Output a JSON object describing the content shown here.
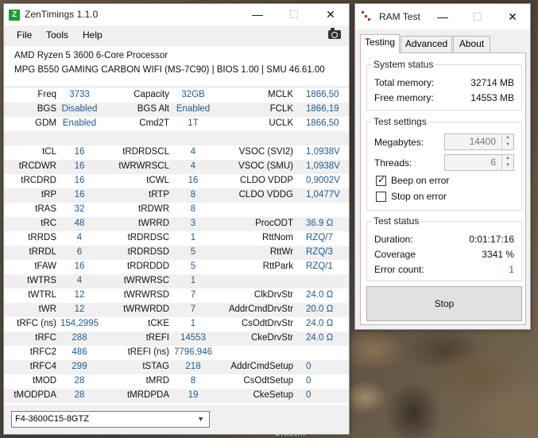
{
  "desktop": {
    "caption": "Braucht"
  },
  "zentimings": {
    "title": "ZenTimings 1.1.0",
    "logo_letter": "Z",
    "window_controls": {
      "minimize": "—",
      "maximize": "☐",
      "close": "✕"
    },
    "menu": [
      "File",
      "Tools",
      "Help"
    ],
    "screenshot_icon": "camera-icon",
    "cpu": "AMD Ryzen 5 3600 6-Core Processor",
    "board": "MPG B550 GAMING CARBON WIFI (MS-7C90) | BIOS 1.00 | SMU 46.61.00",
    "rows": [
      [
        "Freq",
        "3733",
        "Capacity",
        "32GB",
        "MCLK",
        "1866,50"
      ],
      [
        "BGS",
        "Disabled",
        "BGS Alt",
        "Enabled",
        "FCLK",
        "1866,19"
      ],
      [
        "GDM",
        "Enabled",
        "Cmd2T",
        "1T",
        "UCLK",
        "1866,50"
      ],
      [
        "",
        "",
        "",
        "",
        "",
        ""
      ],
      [
        "tCL",
        "16",
        "tRDRDSCL",
        "4",
        "VSOC (SVI2)",
        "1,0938V"
      ],
      [
        "tRCDWR",
        "16",
        "tWRWRSCL",
        "4",
        "VSOC (SMU)",
        "1,0938V"
      ],
      [
        "tRCDRD",
        "16",
        "tCWL",
        "16",
        "CLDO VDDP",
        "0,9002V"
      ],
      [
        "tRP",
        "16",
        "tRTP",
        "8",
        "CLDO VDDG",
        "1,0477V"
      ],
      [
        "tRAS",
        "32",
        "tRDWR",
        "8",
        "",
        ""
      ],
      [
        "tRC",
        "48",
        "tWRRD",
        "3",
        "ProcODT",
        "36.9 Ω"
      ],
      [
        "tRRDS",
        "4",
        "tRDRDSC",
        "1",
        "RttNom",
        "RZQ/7"
      ],
      [
        "tRRDL",
        "6",
        "tRDRDSD",
        "5",
        "RttWr",
        "RZQ/3"
      ],
      [
        "tFAW",
        "16",
        "tRDRDDD",
        "5",
        "RttPark",
        "RZQ/1"
      ],
      [
        "tWTRS",
        "4",
        "tWRWRSC",
        "1",
        "",
        ""
      ],
      [
        "tWTRL",
        "12",
        "tWRWRSD",
        "7",
        "ClkDrvStr",
        "24.0 Ω"
      ],
      [
        "tWR",
        "12",
        "tWRWRDD",
        "7",
        "AddrCmdDrvStr",
        "20.0 Ω"
      ],
      [
        "tRFC (ns)",
        "154,2995",
        "tCKE",
        "1",
        "CsOdtDrvStr",
        "24.0 Ω"
      ],
      [
        "tRFC",
        "288",
        "tREFI",
        "14553",
        "CkeDrvStr",
        "24.0 Ω"
      ],
      [
        "tRFC2",
        "486",
        "tREFI (ns)",
        "7796,946",
        "",
        ""
      ],
      [
        "tRFC4",
        "299",
        "tSTAG",
        "218",
        "AddrCmdSetup",
        "0"
      ],
      [
        "tMOD",
        "28",
        "tMRD",
        "8",
        "CsOdtSetup",
        "0"
      ],
      [
        "tMODPDA",
        "28",
        "tMRDPDA",
        "19",
        "CkeSetup",
        "0"
      ]
    ],
    "profile_select": "F4-3600C15-8GTZ"
  },
  "ramtest": {
    "title": "RAM Test",
    "window_controls": {
      "minimize": "—",
      "maximize": "☐",
      "close": "✕"
    },
    "tabs": [
      "Testing",
      "Advanced",
      "About"
    ],
    "system_status": {
      "title": "System status",
      "total_label": "Total memory:",
      "total_value": "32714 MB",
      "free_label": "Free memory:",
      "free_value": "14553 MB"
    },
    "test_settings": {
      "title": "Test settings",
      "megabytes_label": "Megabytes:",
      "megabytes_value": "14400",
      "threads_label": "Threads:",
      "threads_value": "6",
      "beep_label": "Beep on error",
      "beep_checked": true,
      "stop_label": "Stop on error",
      "stop_checked": false
    },
    "test_status": {
      "title": "Test status",
      "duration_label": "Duration:",
      "duration_value": "0:01:17:16",
      "coverage_label": "Coverage",
      "coverage_value": "3341 %",
      "errors_label": "Error count:",
      "errors_value": "1",
      "error_color": "#c0392b"
    },
    "stop_button": "Stop"
  }
}
